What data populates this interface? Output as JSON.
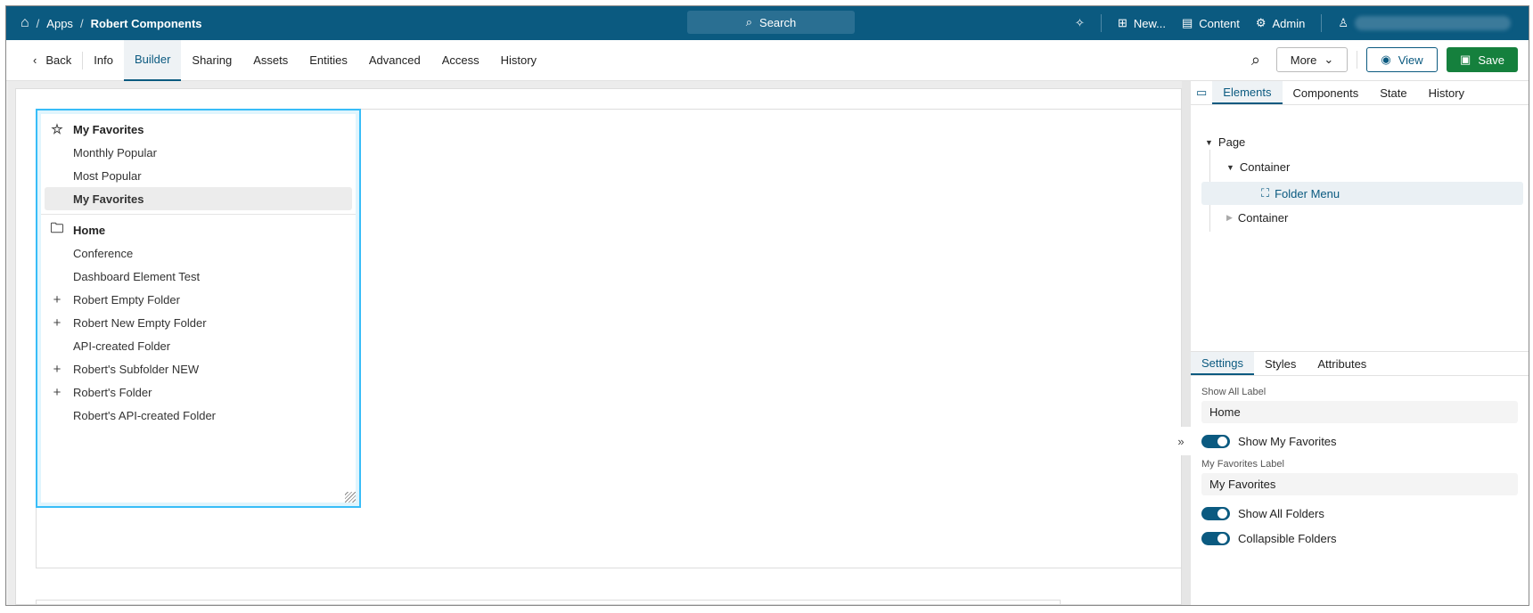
{
  "topbar": {
    "breadcrumb": [
      "Apps",
      "Robert Components"
    ],
    "search": "Search",
    "new": "New...",
    "content": "Content",
    "admin": "Admin"
  },
  "nav": {
    "back": "Back",
    "tabs": [
      "Info",
      "Builder",
      "Sharing",
      "Assets",
      "Entities",
      "Advanced",
      "Access",
      "History"
    ],
    "active": "Builder",
    "more": "More",
    "view": "View",
    "save": "Save"
  },
  "folder_menu": {
    "favorites_header": "My Favorites",
    "favorites": [
      "Monthly Popular",
      "Most Popular",
      "My Favorites"
    ],
    "selected": "My Favorites",
    "home_header": "Home",
    "folders": [
      {
        "label": "Conference",
        "expandable": false
      },
      {
        "label": "Dashboard Element Test",
        "expandable": false
      },
      {
        "label": "Robert Empty Folder",
        "expandable": true
      },
      {
        "label": "Robert New Empty Folder",
        "expandable": true
      },
      {
        "label": "API-created Folder",
        "expandable": false
      },
      {
        "label": "Robert's Subfolder NEW",
        "expandable": true
      },
      {
        "label": "Robert's Folder",
        "expandable": true
      },
      {
        "label": "Robert's API-created Folder",
        "expandable": false
      }
    ]
  },
  "panel": {
    "tabs": [
      "Elements",
      "Components",
      "State",
      "History"
    ],
    "tree": {
      "page": "Page",
      "container1": "Container",
      "folder_menu": "Folder Menu",
      "container2": "Container"
    },
    "settings_tabs": [
      "Settings",
      "Styles",
      "Attributes"
    ],
    "settings": {
      "show_all_label": "Show All Label",
      "show_all_value": "Home",
      "show_my_favorites": "Show My Favorites",
      "my_favorites_label": "My Favorites Label",
      "my_favorites_value": "My Favorites",
      "show_all_folders": "Show All Folders",
      "collapsible_folders": "Collapsible Folders"
    },
    "toggles": {
      "show_my_favorites": true,
      "show_all_folders": true,
      "collapsible_folders": true
    }
  },
  "colors": {
    "brand": "#0b5a80",
    "save": "#15803d",
    "selection": "#38bdf8"
  }
}
